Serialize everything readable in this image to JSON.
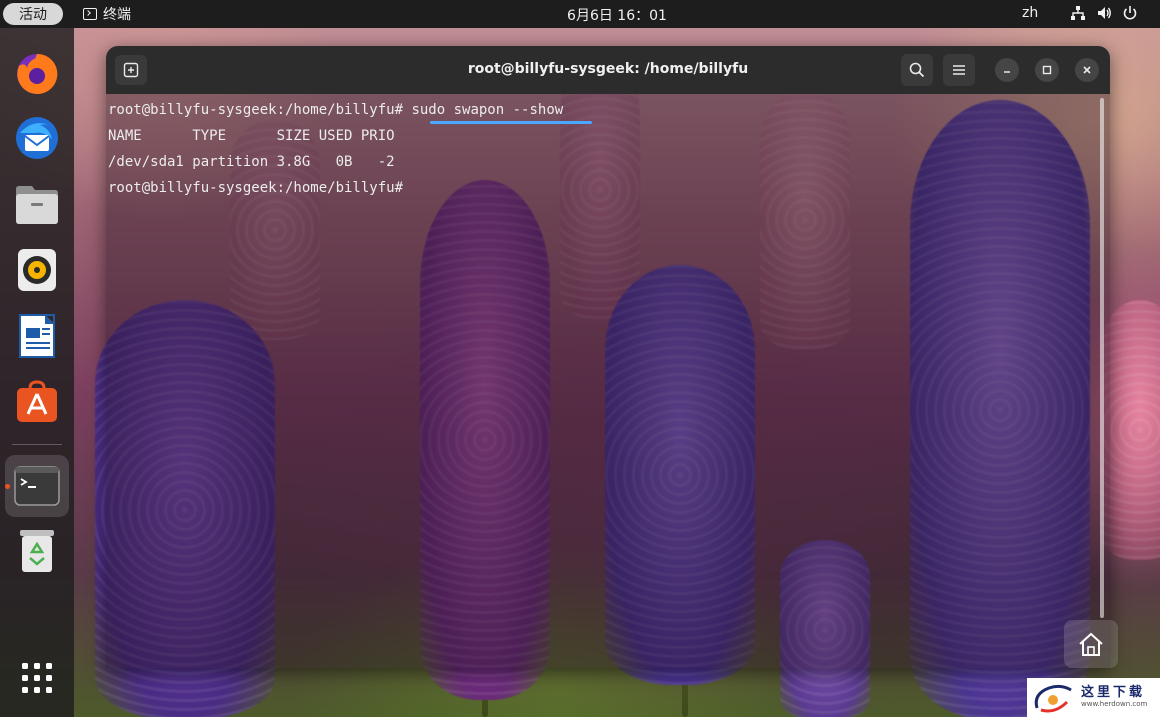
{
  "topbar": {
    "activities": "活动",
    "app_name": "终端",
    "clock": "6月6日  16：01",
    "language": "zh"
  },
  "dock": {
    "items": [
      {
        "name": "firefox-icon"
      },
      {
        "name": "thunderbird-icon"
      },
      {
        "name": "files-icon"
      },
      {
        "name": "rhythmbox-icon"
      },
      {
        "name": "libreoffice-writer-icon"
      },
      {
        "name": "app-center-icon"
      },
      {
        "name": "terminal-icon"
      },
      {
        "name": "trash-icon"
      },
      {
        "name": "show-apps-icon"
      }
    ]
  },
  "terminal": {
    "title": "root@billyfu-sysgeek: /home/billyfu",
    "lines": [
      {
        "prompt": "root@billyfu-sysgeek:/home/billyfu#",
        "command": "sudo swapon --show"
      },
      {
        "text": "NAME      TYPE      SIZE USED PRIO"
      },
      {
        "text": "/dev/sda1 partition 3.8G   0B   -2"
      },
      {
        "prompt": "root@billyfu-sysgeek:/home/billyfu#",
        "command": ""
      }
    ]
  },
  "watermark": {
    "title": "这里下载",
    "url": "www.herdown.com"
  },
  "colors": {
    "accent": "#e95420",
    "highlight_underline": "#4aa8ff",
    "topbar": "#1d1d1d",
    "titlebar": "#2c2c2c"
  }
}
